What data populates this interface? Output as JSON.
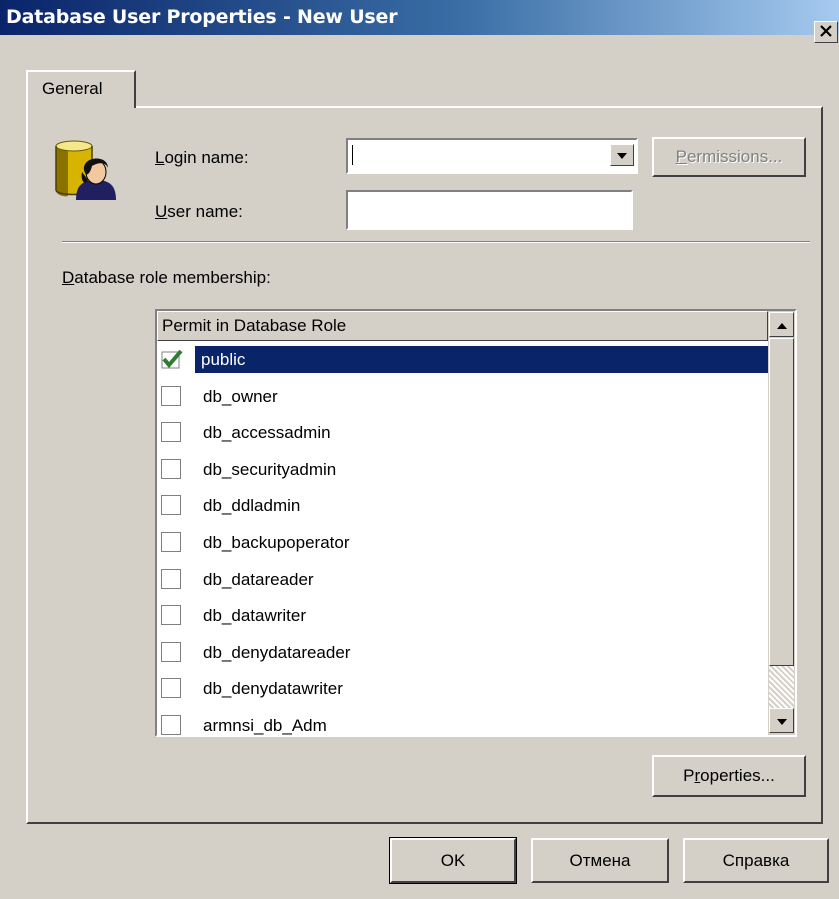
{
  "window": {
    "title": "Database User Properties - New User",
    "close_glyph": "✕"
  },
  "tabs": [
    {
      "label": "General",
      "active": true
    }
  ],
  "form": {
    "login_name": {
      "label_prefix": "",
      "label_accel": "L",
      "label_rest": "ogin name:",
      "value": ""
    },
    "user_name": {
      "label_accel": "U",
      "label_rest": "ser name:",
      "value": ""
    },
    "permissions_button": {
      "accel": "P",
      "rest": "ermissions...",
      "enabled": false
    }
  },
  "roles": {
    "label_accel": "D",
    "label_rest": "atabase role membership:",
    "column_header": "Permit in Database Role",
    "items": [
      {
        "name": "public",
        "checked": true,
        "selected": true
      },
      {
        "name": "db_owner",
        "checked": false,
        "selected": false
      },
      {
        "name": "db_accessadmin",
        "checked": false,
        "selected": false
      },
      {
        "name": "db_securityadmin",
        "checked": false,
        "selected": false
      },
      {
        "name": "db_ddladmin",
        "checked": false,
        "selected": false
      },
      {
        "name": "db_backupoperator",
        "checked": false,
        "selected": false
      },
      {
        "name": "db_datareader",
        "checked": false,
        "selected": false
      },
      {
        "name": "db_datawriter",
        "checked": false,
        "selected": false
      },
      {
        "name": "db_denydatareader",
        "checked": false,
        "selected": false
      },
      {
        "name": "db_denydatawriter",
        "checked": false,
        "selected": false
      },
      {
        "name": "armnsi_db_Adm",
        "checked": false,
        "selected": false
      }
    ],
    "properties_button": {
      "pre": "P",
      "accel": "r",
      "rest": "operties..."
    }
  },
  "footer": {
    "ok_label": "OK",
    "cancel_label": "Отмена",
    "help_label": "Справка"
  },
  "icons": {
    "user_icon": "database-user-icon",
    "check_color": "#2e7d32"
  },
  "colors": {
    "face": "#d4d0c8",
    "title_start": "#0a246a",
    "title_end": "#a6caf0",
    "selection": "#0a246a"
  }
}
